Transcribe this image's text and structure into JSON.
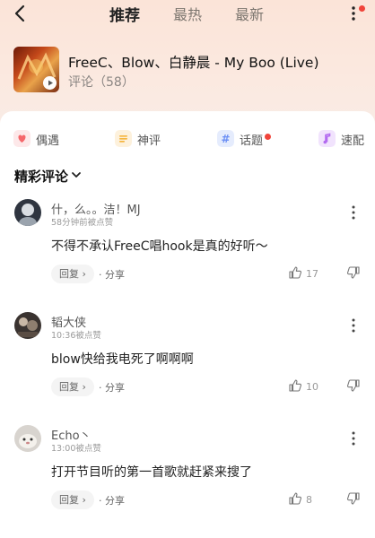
{
  "header": {
    "tabs": [
      "推荐",
      "最热",
      "最新"
    ],
    "active_tab": 0
  },
  "song": {
    "title": "FreeC、Blow、白静晨 - My Boo (Live)",
    "comments_label": "评论（58）"
  },
  "chips": [
    {
      "label": "偶遇",
      "icon": "heart-icon",
      "color": "#f5676b",
      "bg": "#fde8e9"
    },
    {
      "label": "神评",
      "icon": "list-icon",
      "color": "#f5b43a",
      "bg": "#fdf1dc"
    },
    {
      "label": "话题",
      "icon": "hash-icon",
      "color": "#6b8ff5",
      "bg": "#e5ecfd",
      "dot": true
    },
    {
      "label": "速配",
      "icon": "music-note-icon",
      "color": "#b36bf0",
      "bg": "#f1e3fd"
    }
  ],
  "section": {
    "title": "精彩评论"
  },
  "comments": [
    {
      "user": "什，么。。洁！MJ",
      "time": "58分钟前被点赞",
      "text": "不得不承认FreeC唱hook是真的好听～",
      "reply": "回复 ›",
      "share": "· 分享",
      "likes": "17"
    },
    {
      "user": "韬大侠",
      "time": "10:36被点赞",
      "text": "blow快给我电死了啊啊啊",
      "reply": "回复 ›",
      "share": "· 分享",
      "likes": "10"
    },
    {
      "user": "Echo丶",
      "time": "13:00被点赞",
      "text": "打开节目听的第一首歌就赶紧来搜了",
      "reply": "回复 ›",
      "share": "· 分享",
      "likes": "8"
    }
  ],
  "colors": {
    "notification_dot": "#f0443a"
  }
}
